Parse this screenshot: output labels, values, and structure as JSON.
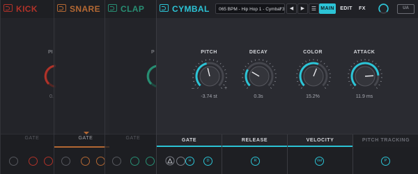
{
  "tracks": [
    {
      "id": "kick",
      "label": "KICK",
      "color": "#e23a2c",
      "section": "GATE",
      "value_partial": "0."
    },
    {
      "id": "snare",
      "label": "SNARE",
      "color": "#e7823a",
      "section": "GATE"
    },
    {
      "id": "clap",
      "label": "CLAP",
      "color": "#2db58f",
      "section": "GATE",
      "value_partial": "P"
    },
    {
      "id": "cymbal",
      "label": "CYMBAL",
      "color": "#2cc4d6"
    }
  ],
  "kick_peek": {
    "param_label": "PI",
    "value": "0."
  },
  "clap_peek": {
    "param_label": "P"
  },
  "cymbal": {
    "preset": "065 BPM - Hip Hop 1 - Cymbal 3",
    "nav_prev": "◀",
    "nav_next": "▶",
    "menu_icon": "☰",
    "tabs": [
      "MAIN",
      "EDIT",
      "FX"
    ],
    "active_tab": "MAIN",
    "logo_text": "UA",
    "knobs": [
      {
        "label": "PITCH",
        "value": "-3.74 st",
        "min_mark": "–",
        "max_mark": "+",
        "level": 0.45
      },
      {
        "label": "DECAY",
        "value": "0.3s",
        "level": 0.28
      },
      {
        "label": "COLOR",
        "value": "15.2%",
        "level": 0.58
      },
      {
        "label": "ATTACK",
        "value": "11.9 ms",
        "level": 0.82
      }
    ],
    "sections": [
      {
        "label": "GATE",
        "active": true
      },
      {
        "label": "RELEASE",
        "active": true
      },
      {
        "label": "VELOCITY",
        "active": true
      },
      {
        "label": "PITCH TRACKING",
        "active": false
      }
    ],
    "mini_knobs": [
      {
        "label": "H"
      },
      {
        "label": "D"
      },
      {
        "label": "R"
      },
      {
        "label": "Vel"
      },
      {
        "label": "P"
      }
    ]
  },
  "colors": {
    "accent": "#2cc4d6",
    "kick": "#e23a2c",
    "snare": "#e7823a",
    "clap": "#2db58f"
  }
}
